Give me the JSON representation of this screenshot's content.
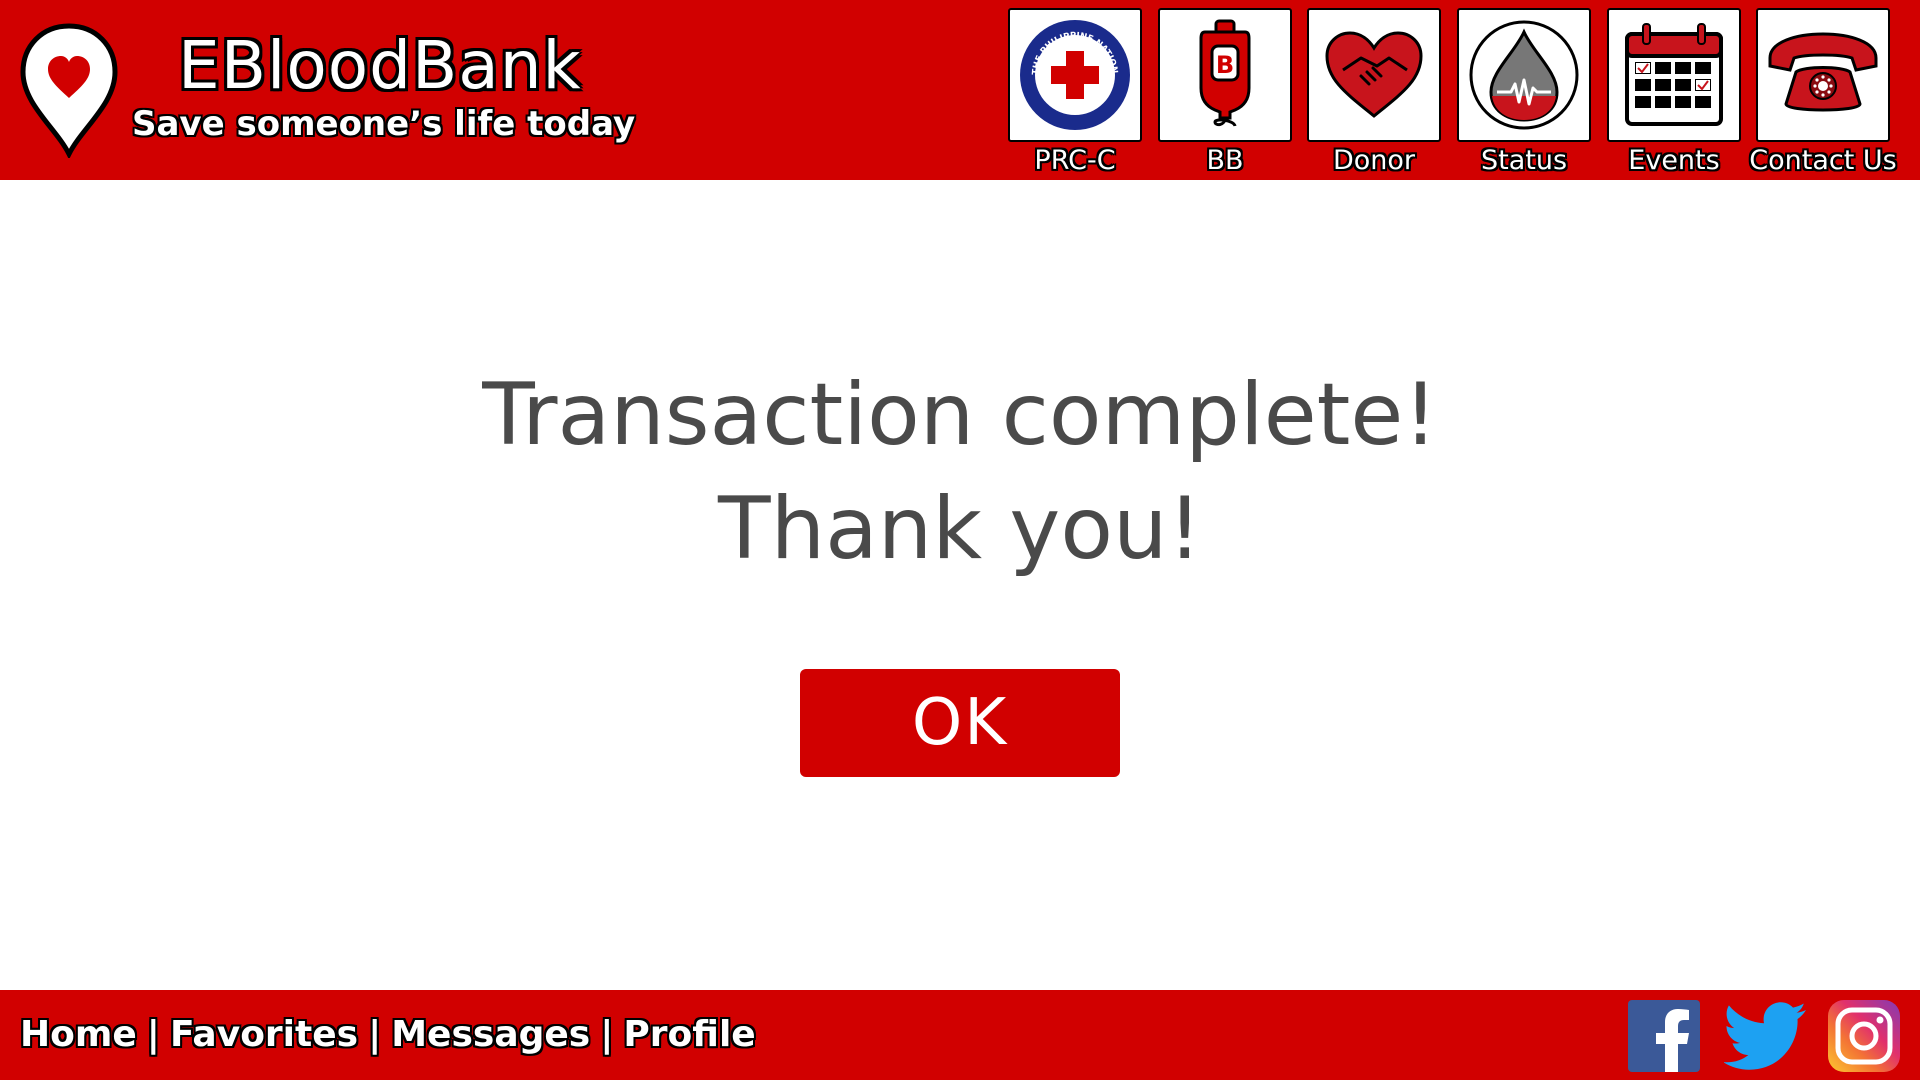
{
  "brand": {
    "title": "EBloodBank",
    "tagline": "Save someone’s life today",
    "logo_icon": "heart-location-pin-icon",
    "color": "#d10000"
  },
  "nav": [
    {
      "label": "PRC-C",
      "icon": "philippine-red-cross-icon",
      "logo_text": "THE PHILIPPINE NATIONAL RED CROSS"
    },
    {
      "label": "BB",
      "icon": "blood-bag-icon",
      "logo_text": "B"
    },
    {
      "label": "Donor",
      "icon": "heart-handshake-icon"
    },
    {
      "label": "Status",
      "icon": "blood-drop-status-icon"
    },
    {
      "label": "Events",
      "icon": "calendar-icon"
    },
    {
      "label": "Contact Us",
      "icon": "telephone-icon"
    }
  ],
  "main": {
    "message_line1": "Transaction complete!",
    "message_line2": "Thank you!",
    "ok_label": "OK",
    "text_color": "#4a4a4a"
  },
  "footer": {
    "links": [
      "Home",
      "Favorites",
      "Messages",
      "Profile"
    ],
    "separator": "|",
    "social": [
      {
        "icon": "facebook-icon",
        "color": "#3b5998"
      },
      {
        "icon": "twitter-icon",
        "color": "#1da1f2"
      },
      {
        "icon": "instagram-icon",
        "color": "#c13584"
      }
    ]
  }
}
